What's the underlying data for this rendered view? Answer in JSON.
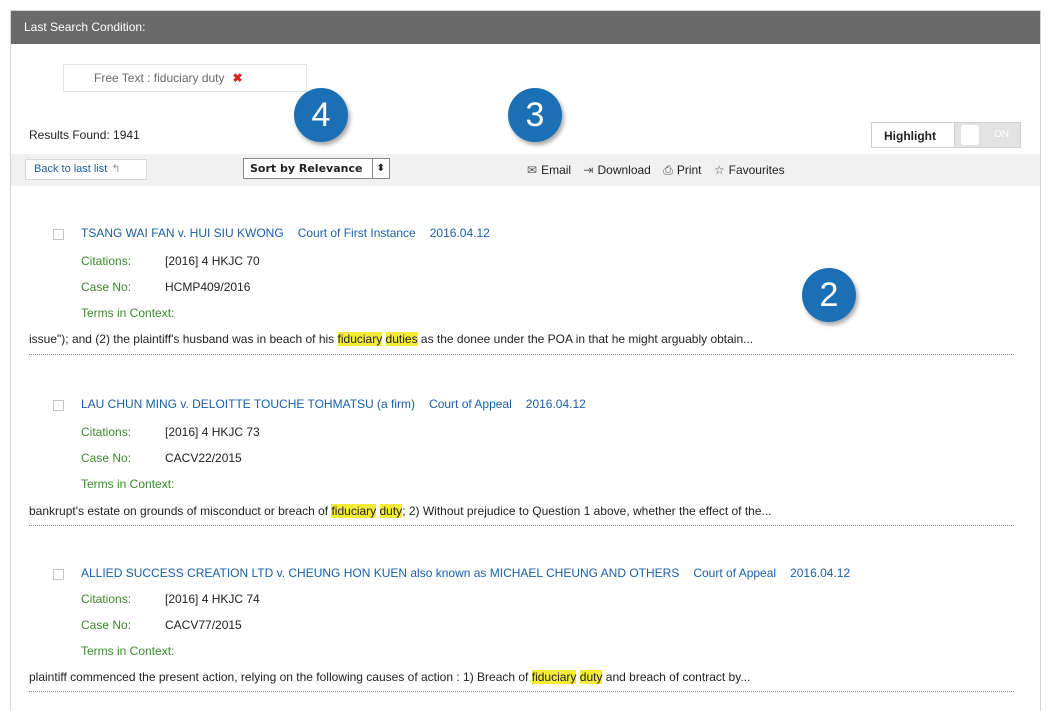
{
  "condition_bar": {
    "title": "Last Search Condition:"
  },
  "filter": {
    "label": "Free Text : fiduciary duty",
    "remove_glyph": "✖"
  },
  "callouts": [
    "4",
    "3",
    "2"
  ],
  "results_found": "Results Found: 1941",
  "highlight": {
    "label": "Highlight",
    "toggle_state": "ON"
  },
  "toolbar": {
    "back_label": "Back to last list",
    "back_arrow": "↰",
    "sort_label": "Sort by Relevance",
    "sort_arrows": "⬍",
    "email": "Email",
    "download": "Download",
    "print": "Print",
    "favourites": "Favourites",
    "email_icon": "✉",
    "download_icon": "⇥",
    "print_icon": "⎙",
    "favourites_icon": "☆"
  },
  "labels": {
    "citations": "Citations:",
    "case_no": "Case No:",
    "terms_in_context": "Terms in Context:"
  },
  "results": [
    {
      "title": "TSANG WAI FAN v. HUI SIU KWONG",
      "court": "Court of First Instance",
      "date": "2016.04.12",
      "citation": "[2016] 4 HKJC 70",
      "case_no": "HCMP409/2016",
      "context_before": "issue\"); and (2) the plaintiff's husband was in beach of his ",
      "hl1": "fiduciary",
      "hl2": "duties",
      "context_after": " as the donee under the POA in that he might arguably obtain..."
    },
    {
      "title": "LAU CHUN MING v. DELOITTE TOUCHE TOHMATSU (a firm)",
      "court": "Court of Appeal",
      "date": "2016.04.12",
      "citation": "[2016] 4 HKJC 73",
      "case_no": "CACV22/2015",
      "context_before": "bankrupt's estate on grounds of misconduct or breach of ",
      "hl1": "fiduciary",
      "hl2": "duty",
      "context_after": "; 2) Without prejudice to Question 1 above, whether the effect of the..."
    },
    {
      "title": "ALLIED SUCCESS CREATION LTD v. CHEUNG HON KUEN also known as MICHAEL CHEUNG AND OTHERS",
      "court": "Court of Appeal",
      "date": "2016.04.12",
      "citation": "[2016] 4 HKJC 74",
      "case_no": "CACV77/2015",
      "context_before": "plaintiff commenced the present action, relying on the following causes of action : 1) Breach of ",
      "hl1": "fiduciary",
      "hl2": "duty",
      "context_after": " and breach of contract by..."
    }
  ],
  "colors": {
    "link": "#1b5fa8",
    "label_green": "#3a8a2a",
    "highlight": "#f4ea3a",
    "callout": "#1b70b5",
    "header_bar": "#6a6a6a"
  }
}
